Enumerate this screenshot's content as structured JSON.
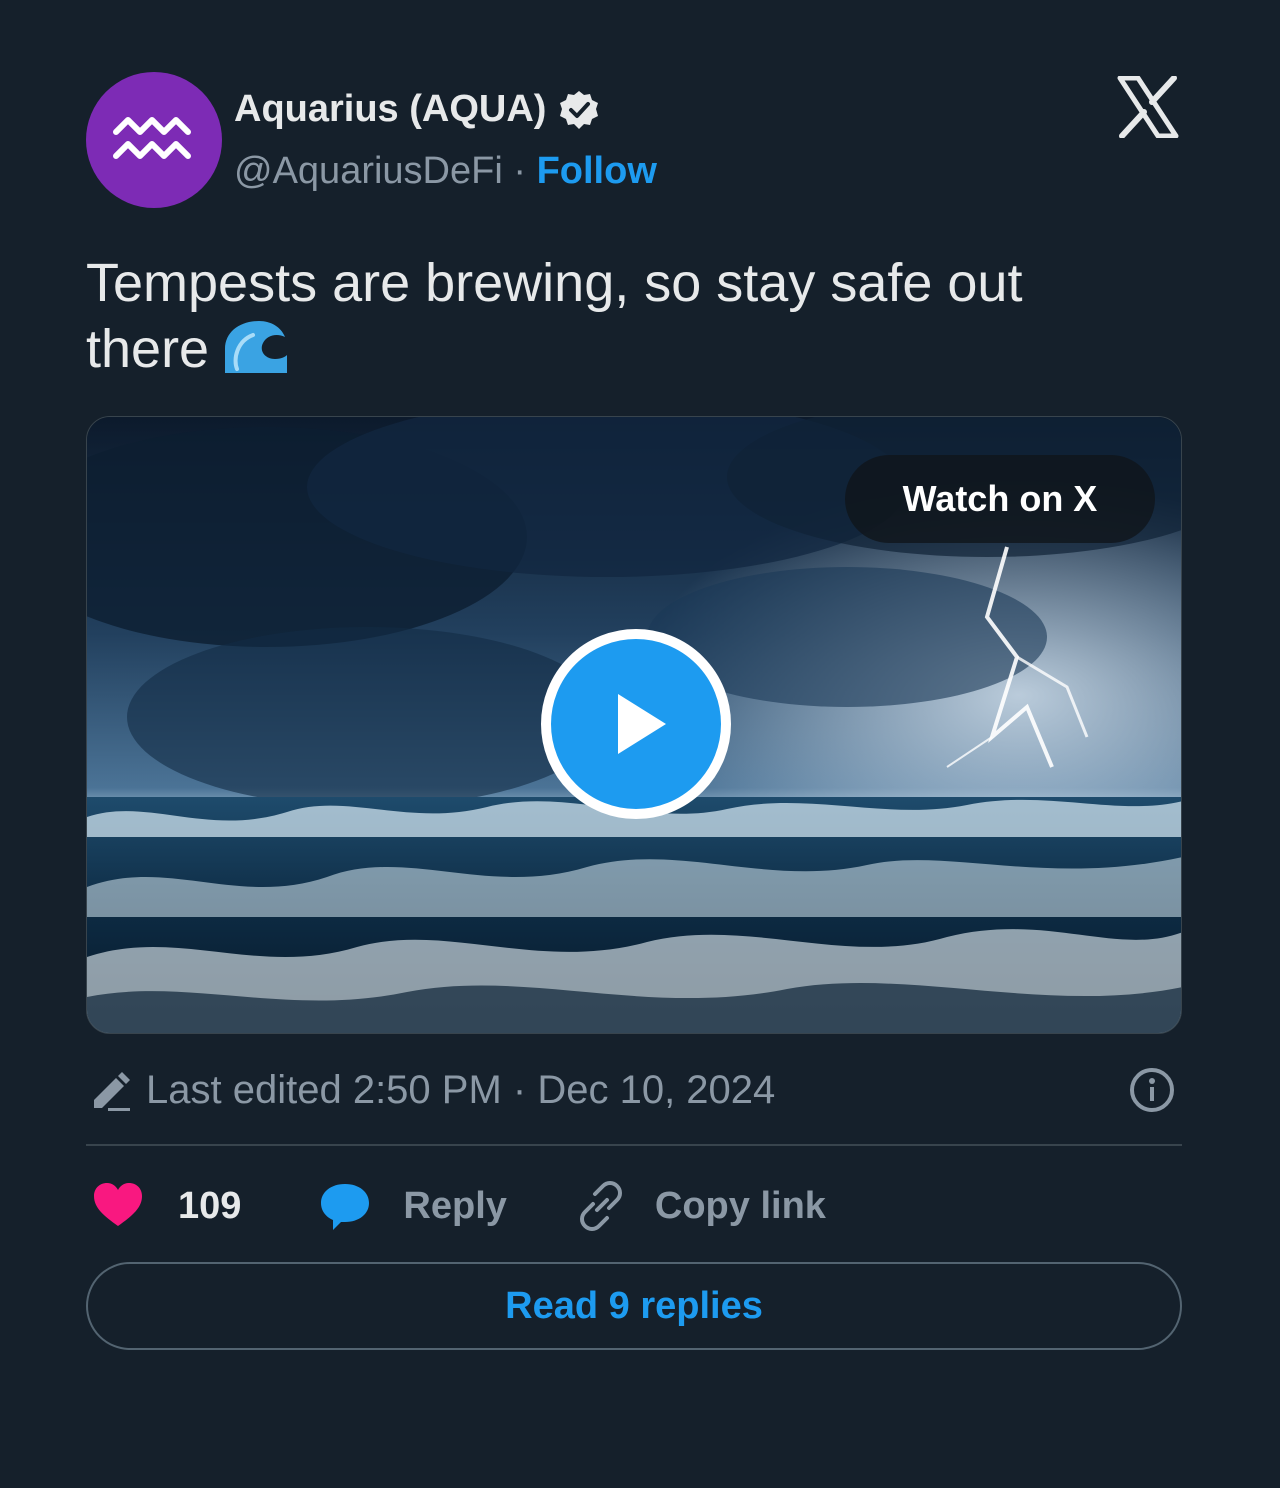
{
  "author": {
    "display_name": "Aquarius (AQUA)",
    "handle": "@AquariusDeFi",
    "separator": "·",
    "follow_label": "Follow",
    "avatar_color": "#7d2bb5",
    "verified": true
  },
  "tweet": {
    "text": "Tempests are brewing, so stay safe out there",
    "emoji": "wave-emoji"
  },
  "media": {
    "type": "video",
    "watch_label": "Watch on X"
  },
  "meta": {
    "edited_text": "Last edited 2:50 PM · Dec 10, 2024"
  },
  "actions": {
    "like_count": "109",
    "reply_label": "Reply",
    "copy_label": "Copy link"
  },
  "footer": {
    "read_replies_label": "Read 9 replies"
  },
  "colors": {
    "background": "#15202b",
    "accent": "#1d9bf0",
    "like": "#f91880",
    "muted": "#8b98a5"
  }
}
